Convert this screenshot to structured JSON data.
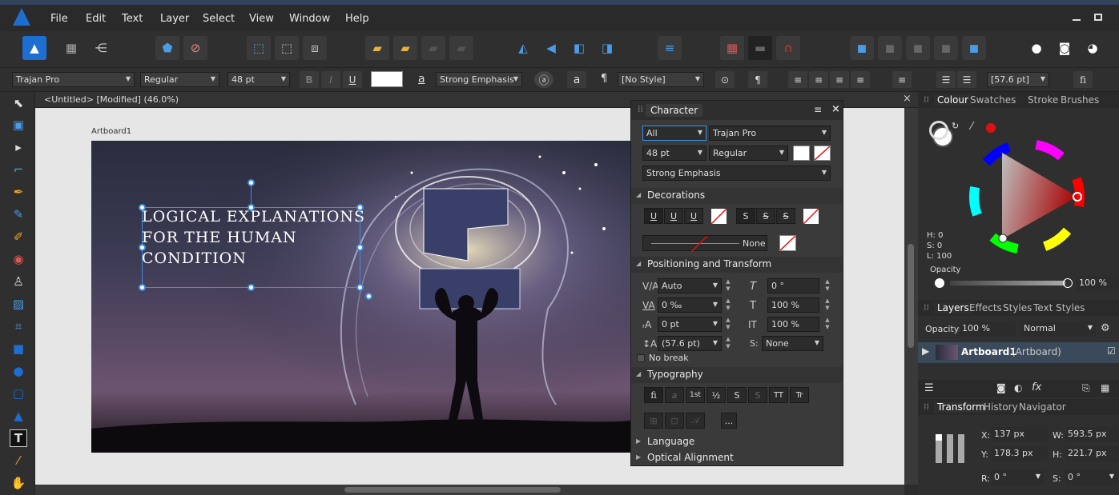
{
  "menu": [
    "File",
    "Edit",
    "Text",
    "Layer",
    "Select",
    "View",
    "Window",
    "Help"
  ],
  "context": {
    "font": "Trajan Pro",
    "style": "Regular",
    "size": "48 pt",
    "char_style": "Strong Emphasis",
    "para_style": "[No Style]",
    "leading": "[57.6 pt]",
    "fi": "fi",
    "bold": "B",
    "italic": "I",
    "underline": "U",
    "a_glyph": "a",
    "pilcrow": "¶"
  },
  "document": {
    "tab_title": "<Untitled> [Modified] (46.0%)",
    "artboard_label": "Artboard1",
    "text_lines": [
      "LOGICAL EXPLANATIONS",
      "FOR THE HUMAN",
      "CONDITION"
    ]
  },
  "character_panel": {
    "title": "Character",
    "scope": "All",
    "font": "Trajan Pro",
    "size": "48 pt",
    "style": "Regular",
    "char_style": "Strong Emphasis",
    "decorations_title": "Decorations",
    "line_none": "None",
    "positioning_title": "Positioning and Transform",
    "tracking": "Auto",
    "kerning": "0 ‰",
    "baseline": "0 pt",
    "leading": "(57.6 pt)",
    "shear": "0 °",
    "hscale": "100 %",
    "vscale": "100 %",
    "scale_label": "IT",
    "s_label": "S:",
    "s_value": "None",
    "no_break": "No break",
    "typography_title": "Typography",
    "typo_buttons": [
      "fi",
      "a",
      "1st",
      "½",
      "S",
      "S",
      "TT",
      "Tr"
    ],
    "dots": "...",
    "language": "Language",
    "optical": "Optical Alignment"
  },
  "colour_panel": {
    "tabs": [
      "Colour",
      "Swatches",
      "Stroke",
      "Brushes"
    ],
    "h": "H: 0",
    "s": "S: 0",
    "l": "L: 100",
    "opacity_label": "Opacity",
    "opacity_value": "100 %"
  },
  "layers_panel": {
    "tabs": [
      "Layers",
      "Effects",
      "Styles",
      "Text Styles"
    ],
    "opacity_label": "Opacity:",
    "opacity_value": "100 %",
    "blend": "Normal",
    "layer_name": "Artboard1",
    "layer_type": "(Artboard)"
  },
  "transform_panel": {
    "tabs": [
      "Transform",
      "History",
      "Navigator"
    ],
    "x_label": "X:",
    "x": "137 px",
    "y_label": "Y:",
    "y": "178.3 px",
    "w_label": "W:",
    "w": "593.5 px",
    "h_label": "H:",
    "h": "221.7 px",
    "r_label": "R:",
    "r": "0 °",
    "s_label": "S:",
    "s": "0 °"
  },
  "colors": {
    "accent": "#3d8fe0",
    "affinity_blue": "#1c6fd1",
    "red_dot": "#e01010"
  }
}
